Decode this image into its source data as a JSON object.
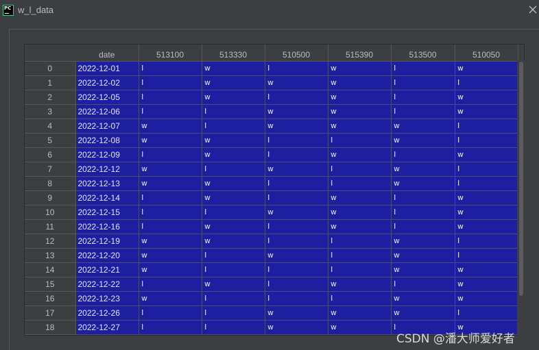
{
  "window": {
    "title": "w_l_data",
    "app_icon": "pycharm-icon",
    "close_icon": "close-icon"
  },
  "table": {
    "columns": [
      "",
      "date",
      "513100",
      "513330",
      "510500",
      "515390",
      "513500",
      "510050"
    ],
    "rows": [
      {
        "index": "0",
        "date": "2022-12-01",
        "values": [
          "l",
          "w",
          "l",
          "w",
          "l",
          "w"
        ]
      },
      {
        "index": "1",
        "date": "2022-12-02",
        "values": [
          "l",
          "w",
          "w",
          "w",
          "l",
          "l"
        ]
      },
      {
        "index": "2",
        "date": "2022-12-05",
        "values": [
          "l",
          "w",
          "l",
          "w",
          "l",
          "w"
        ]
      },
      {
        "index": "3",
        "date": "2022-12-06",
        "values": [
          "l",
          "l",
          "w",
          "w",
          "l",
          "w"
        ]
      },
      {
        "index": "4",
        "date": "2022-12-07",
        "values": [
          "w",
          "l",
          "w",
          "w",
          "w",
          "l"
        ]
      },
      {
        "index": "5",
        "date": "2022-12-08",
        "values": [
          "w",
          "w",
          "l",
          "l",
          "w",
          "l"
        ]
      },
      {
        "index": "6",
        "date": "2022-12-09",
        "values": [
          "l",
          "w",
          "l",
          "w",
          "l",
          "w"
        ]
      },
      {
        "index": "7",
        "date": "2022-12-12",
        "values": [
          "w",
          "l",
          "w",
          "l",
          "w",
          "l"
        ]
      },
      {
        "index": "8",
        "date": "2022-12-13",
        "values": [
          "w",
          "w",
          "l",
          "l",
          "w",
          "l"
        ]
      },
      {
        "index": "9",
        "date": "2022-12-14",
        "values": [
          "l",
          "w",
          "l",
          "w",
          "l",
          "w"
        ]
      },
      {
        "index": "10",
        "date": "2022-12-15",
        "values": [
          "l",
          "l",
          "w",
          "w",
          "l",
          "w"
        ]
      },
      {
        "index": "11",
        "date": "2022-12-16",
        "values": [
          "l",
          "w",
          "l",
          "w",
          "l",
          "w"
        ]
      },
      {
        "index": "12",
        "date": "2022-12-19",
        "values": [
          "w",
          "w",
          "l",
          "l",
          "w",
          "l"
        ]
      },
      {
        "index": "13",
        "date": "2022-12-20",
        "values": [
          "w",
          "l",
          "w",
          "l",
          "w",
          "l"
        ]
      },
      {
        "index": "14",
        "date": "2022-12-21",
        "values": [
          "w",
          "l",
          "l",
          "l",
          "w",
          "w"
        ]
      },
      {
        "index": "15",
        "date": "2022-12-22",
        "values": [
          "l",
          "w",
          "l",
          "w",
          "l",
          "w"
        ]
      },
      {
        "index": "16",
        "date": "2022-12-23",
        "values": [
          "w",
          "l",
          "l",
          "l",
          "w",
          "w"
        ]
      },
      {
        "index": "17",
        "date": "2022-12-26",
        "values": [
          "l",
          "l",
          "w",
          "w",
          "w",
          "l"
        ]
      },
      {
        "index": "18",
        "date": "2022-12-27",
        "values": [
          "l",
          "l",
          "w",
          "w",
          "l",
          "w"
        ]
      }
    ]
  },
  "watermark": "CSDN @潘大师爱好者",
  "colors": {
    "background": "#3c3f41",
    "cell_selected": "#1e1ea0",
    "text": "#bbbbbb"
  }
}
